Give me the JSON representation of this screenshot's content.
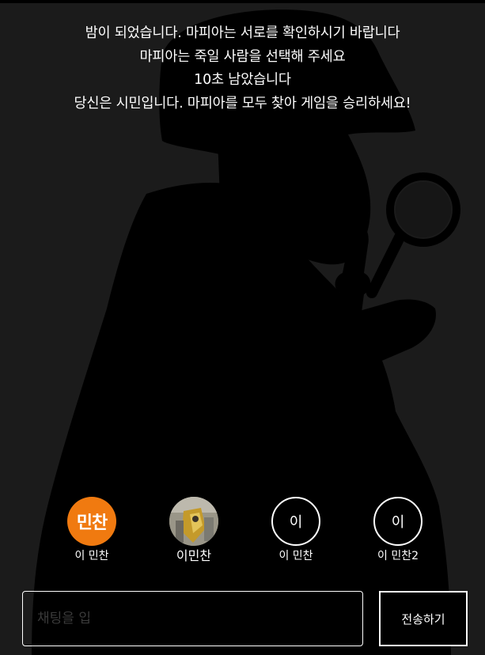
{
  "announcement": {
    "line1": "밤이 되었습니다. 마피아는 서로를 확인하시기 바랍니다",
    "line2": "마피아는 죽일 사람을 선택해 주세요",
    "line3": "10초 남았습니다",
    "line4": "당신은 시민입니다. 마피아를 모두 찾아 게임을 승리하세요!"
  },
  "players": [
    {
      "avatar_text": "민찬",
      "name": "이 민찬",
      "avatar_color": "#f07a10"
    },
    {
      "avatar_text": "",
      "name": "이민찬",
      "avatar_type": "photo"
    },
    {
      "avatar_text": "이",
      "name": "이 민찬"
    },
    {
      "avatar_text": "이",
      "name": "이 민찬2"
    }
  ],
  "chat": {
    "placeholder": "채팅을 입",
    "send_label": "전송하기"
  },
  "colors": {
    "background": "#1b1b1b",
    "silhouette": "#000000",
    "accent_orange": "#f07a10"
  }
}
